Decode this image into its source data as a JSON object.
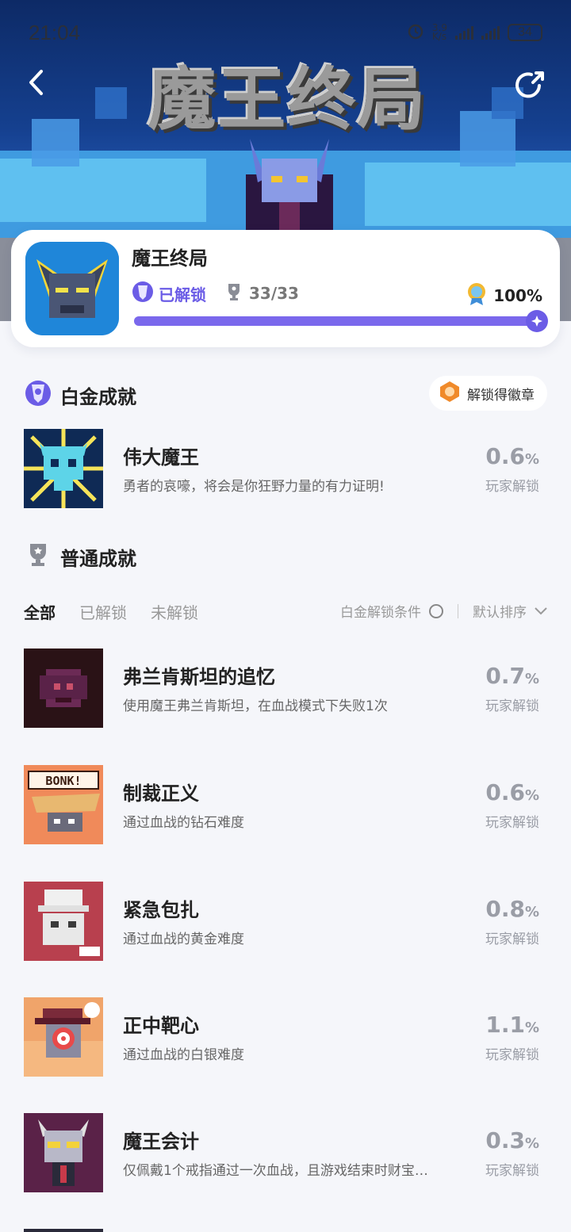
{
  "status_bar": {
    "time": "21:04",
    "net_speed_top": "3.9",
    "net_speed_unit": "K/s",
    "battery": "34"
  },
  "banner": {
    "logo_text": "魔王终局"
  },
  "game": {
    "title": "魔王终局",
    "unlock_label": "已解锁",
    "trophy_count": "33/33",
    "completion": "100%",
    "progress_fraction": 1.0,
    "accent_color": "#6b5ce6"
  },
  "platinum": {
    "section_title": "白金成就",
    "badge_button": "解锁得徽章",
    "item": {
      "name": "伟大魔王",
      "desc": "勇者的哀嚎，将会是你狂野力量的有力证明!",
      "rate": "0.6",
      "rate_unit": "%",
      "rate_label": "玩家解锁"
    }
  },
  "normal": {
    "section_title": "普通成就",
    "tabs": [
      "全部",
      "已解锁",
      "未解锁"
    ],
    "platinum_condition": "白金解锁条件",
    "sort": "默认排序",
    "items": [
      {
        "name": "弗兰肯斯坦的追忆",
        "desc": "使用魔王弗兰肯斯坦，在血战模式下失败1次",
        "rate": "0.7",
        "rate_unit": "%",
        "rate_label": "玩家解锁"
      },
      {
        "name": "制裁正义",
        "desc": "通过血战的钻石难度",
        "rate": "0.6",
        "rate_unit": "%",
        "rate_label": "玩家解锁"
      },
      {
        "name": "紧急包扎",
        "desc": "通过血战的黄金难度",
        "rate": "0.8",
        "rate_unit": "%",
        "rate_label": "玩家解锁"
      },
      {
        "name": "正中靶心",
        "desc": "通过血战的白银难度",
        "rate": "1.1",
        "rate_unit": "%",
        "rate_label": "玩家解锁"
      },
      {
        "name": "魔王会计",
        "desc": "仅佩戴1个戒指通过一次血战，且游戏结束时财宝…",
        "rate": "0.3",
        "rate_unit": "%",
        "rate_label": "玩家解锁"
      }
    ],
    "ach_image_text": "BONK!"
  }
}
